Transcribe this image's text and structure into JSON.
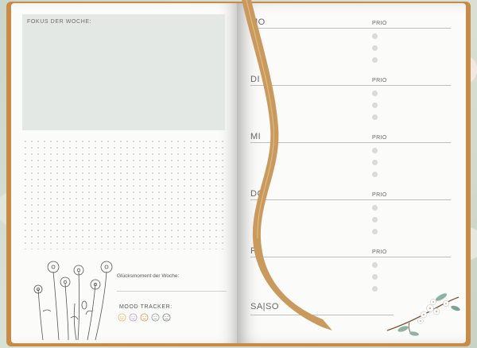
{
  "left_page": {
    "focus_label": "FOKUS DER WOCHE:",
    "gluck_label": "Glücksmoment der Woche:",
    "mood_label": "MOOD TRACKER:",
    "mood_icons": [
      "happy-face-icon",
      "smile-face-icon",
      "neutral-face-icon",
      "sad-face-icon",
      "angry-face-icon"
    ],
    "mood_colors": [
      "#e7c36a",
      "#b9a7c9",
      "#e1a25a",
      "#9aa3a8",
      "#8d8d8d"
    ]
  },
  "right_page": {
    "days": [
      {
        "name": "MO",
        "prio": "PRIO"
      },
      {
        "name": "DI",
        "prio": "PRIO"
      },
      {
        "name": "MI",
        "prio": "PRIO"
      },
      {
        "name": "DO",
        "prio": "PRIO"
      },
      {
        "name": "FR",
        "prio": "PRIO"
      }
    ],
    "weekend": "SA|SO"
  },
  "colors": {
    "cover": "#c98a46",
    "ribbon": "#c99a5b",
    "focus_box": "#e3e8e5"
  }
}
